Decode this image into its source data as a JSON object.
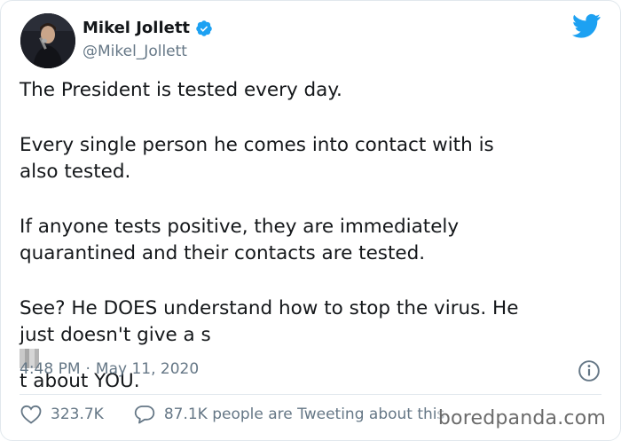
{
  "author": {
    "display_name": "Mikel Jollett",
    "handle": "@Mikel_Jollett",
    "verified": true,
    "avatar_icon": "profile-photo"
  },
  "tweet": {
    "paragraphs": [
      {
        "lines": [
          "The President is tested every day."
        ]
      },
      {
        "lines": [
          "Every single person he comes into contact with is",
          "also tested."
        ]
      },
      {
        "lines": [
          "If anyone tests positive, they are immediately",
          "quarantined and their contacts are tested."
        ]
      }
    ],
    "last_paragraph": {
      "line1": "See? He DOES understand how to stop the virus. He",
      "line2_before": "just doesn't give a s",
      "line2_after": "t about YOU."
    }
  },
  "meta": {
    "time": "4:48 PM",
    "separator": "·",
    "date": "May 11, 2020"
  },
  "actions": {
    "likes": "323.7K",
    "replies_text": "87.1K people are Tweeting about this"
  },
  "watermark": "boredpanda.com",
  "colors": {
    "twitter_blue": "#1da1f2",
    "muted": "#657786",
    "text": "#14171a"
  }
}
